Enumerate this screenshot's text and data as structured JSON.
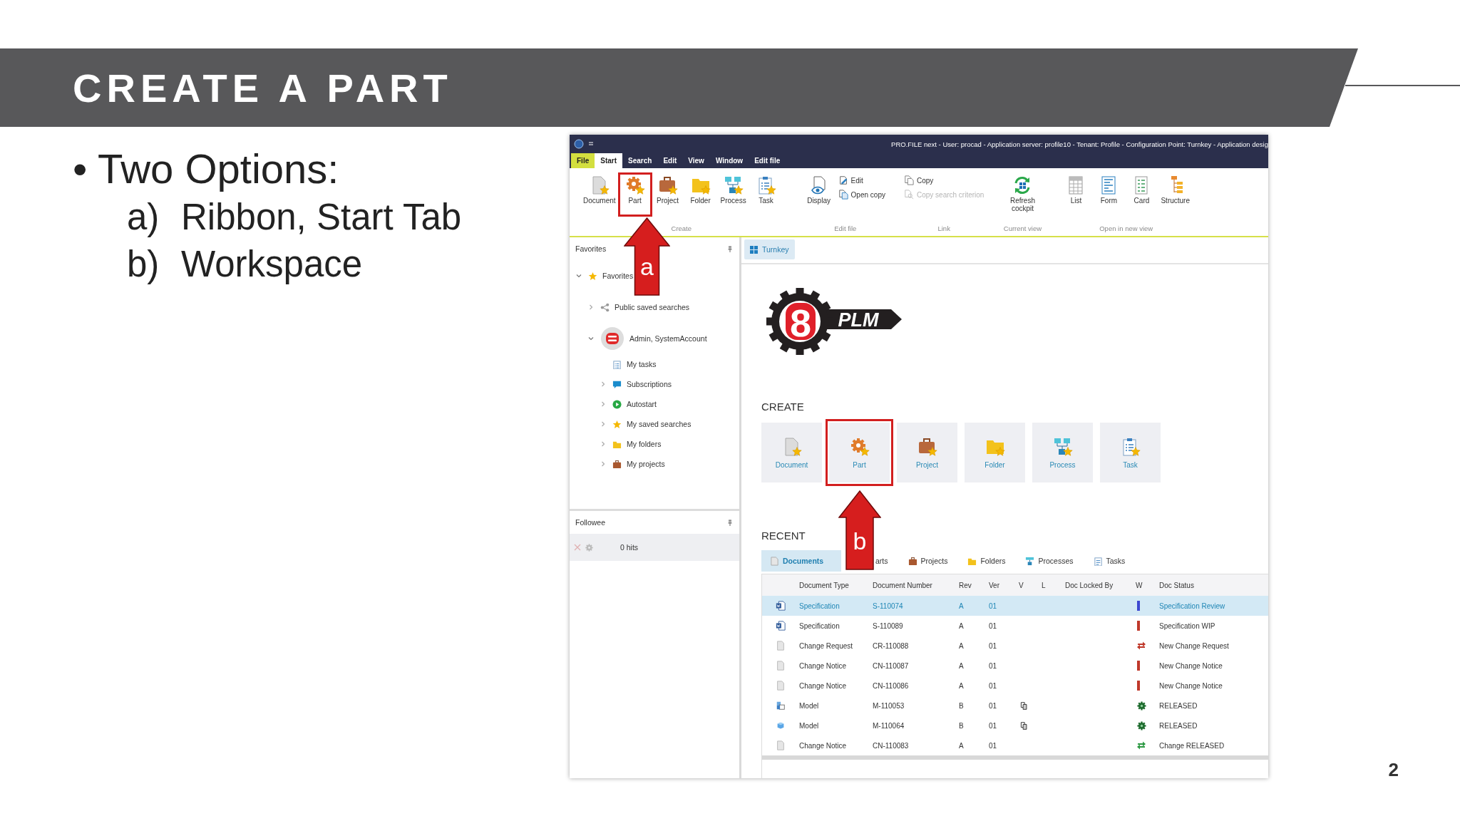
{
  "slide": {
    "title": "CREATE A PART",
    "bullets": [
      {
        "marker": "•",
        "text": "Two Options:",
        "children": [
          {
            "marker": "a)",
            "text": "Ribbon, Start Tab"
          },
          {
            "marker": "b)",
            "text": "Workspace"
          }
        ]
      }
    ],
    "page_number": "2"
  },
  "app": {
    "title_bar": {
      "title": "PRO.FILE next - User: procad - Application server: profile10 - Tenant: Profile - Configuration Point: Turnkey - Application desig"
    },
    "menu_tabs": [
      {
        "label": "File",
        "kind": "file",
        "selected": false
      },
      {
        "label": "Start",
        "kind": "tab",
        "selected": true
      },
      {
        "label": "Search",
        "kind": "tab",
        "selected": false
      },
      {
        "label": "Edit",
        "kind": "tab",
        "selected": false
      },
      {
        "label": "View",
        "kind": "tab",
        "selected": false
      },
      {
        "label": "Window",
        "kind": "tab",
        "selected": false
      },
      {
        "label": "Edit file",
        "kind": "tab",
        "selected": false
      }
    ],
    "ribbon": {
      "groups": [
        {
          "label": "Create",
          "items": [
            {
              "label": "Document",
              "kind": "large",
              "highlighted": false
            },
            {
              "label": "Part",
              "kind": "large",
              "highlighted": true
            },
            {
              "label": "Project",
              "kind": "large",
              "highlighted": false
            },
            {
              "label": "Folder",
              "kind": "large",
              "highlighted": false
            },
            {
              "label": "Process",
              "kind": "large",
              "highlighted": false
            },
            {
              "label": "Task",
              "kind": "large",
              "highlighted": false
            }
          ]
        },
        {
          "label": "Edit file",
          "items": [
            {
              "label": "Display",
              "kind": "large",
              "highlighted": false
            },
            {
              "label": "Edit",
              "kind": "small",
              "disabled": false
            },
            {
              "label": "Open copy",
              "kind": "small",
              "disabled": false
            }
          ]
        },
        {
          "label": "Link",
          "items": [
            {
              "label": "Copy",
              "kind": "small",
              "disabled": false
            },
            {
              "label": "Copy search criterion",
              "kind": "small",
              "disabled": true
            }
          ]
        },
        {
          "label": "Current view",
          "items": [
            {
              "label": "Refresh cockpit",
              "kind": "large",
              "highlighted": false
            }
          ]
        },
        {
          "label": "Open in new view",
          "items": [
            {
              "label": "List",
              "kind": "large",
              "highlighted": false
            },
            {
              "label": "Form",
              "kind": "large",
              "highlighted": false
            },
            {
              "label": "Card",
              "kind": "large",
              "highlighted": false
            },
            {
              "label": "Structure",
              "kind": "large",
              "highlighted": false
            }
          ]
        }
      ]
    },
    "favorites": {
      "title": "Favorites",
      "tree": [
        {
          "label": "Favorites",
          "expanded": true,
          "children": [
            {
              "label": "Public saved searches",
              "expanded": false
            },
            {
              "label": "Admin, SystemAccount",
              "expanded": true,
              "children": [
                {
                  "label": "My tasks"
                },
                {
                  "label": "Subscriptions",
                  "expanded": false
                },
                {
                  "label": "Autostart",
                  "expanded": false
                },
                {
                  "label": "My saved searches",
                  "expanded": false
                },
                {
                  "label": "My folders",
                  "expanded": false
                },
                {
                  "label": "My projects",
                  "expanded": false
                }
              ]
            }
          ]
        }
      ]
    },
    "followee": {
      "title": "Followee",
      "hits": "0 hits"
    },
    "workspace": {
      "tab": {
        "label": "Turnkey",
        "selected": true
      },
      "logo": {
        "mark": "8",
        "text": "PLM"
      },
      "create": {
        "title": "CREATE",
        "tiles": [
          {
            "label": "Document",
            "highlighted": false
          },
          {
            "label": "Part",
            "highlighted": true
          },
          {
            "label": "Project",
            "highlighted": false
          },
          {
            "label": "Folder",
            "highlighted": false
          },
          {
            "label": "Process",
            "highlighted": false
          },
          {
            "label": "Task",
            "highlighted": false
          }
        ]
      },
      "recent": {
        "title": "RECENT",
        "tabs": [
          {
            "label": "Documents",
            "selected": true
          },
          {
            "label": "arts",
            "selected": false
          },
          {
            "label": "Projects",
            "selected": false
          },
          {
            "label": "Folders",
            "selected": false
          },
          {
            "label": "Processes",
            "selected": false
          },
          {
            "label": "Tasks",
            "selected": false
          }
        ],
        "table": {
          "columns": [
            "Document Type",
            "Document Number",
            "Rev",
            "Ver",
            "V",
            "L",
            "Doc Locked By",
            "W",
            "Doc Status"
          ],
          "rows": [
            {
              "selected": true,
              "document_type": "Specification",
              "document_number": "S-110074",
              "rev": "A",
              "ver": "01",
              "v": false,
              "w": {
                "kind": "bar",
                "color": "#3d48d0"
              },
              "doc_status": "Specification Review"
            },
            {
              "selected": false,
              "document_type": "Specification",
              "document_number": "S-110089",
              "rev": "A",
              "ver": "01",
              "v": false,
              "w": {
                "kind": "bar",
                "color": "#c0392b"
              },
              "doc_status": "Specification WIP"
            },
            {
              "selected": false,
              "document_type": "Change Request",
              "document_number": "CR-110088",
              "rev": "A",
              "ver": "01",
              "v": false,
              "w": {
                "kind": "swap",
                "color": "#c0392b"
              },
              "doc_status": "New Change Request"
            },
            {
              "selected": false,
              "document_type": "Change Notice",
              "document_number": "CN-110087",
              "rev": "A",
              "ver": "01",
              "v": false,
              "w": {
                "kind": "bar",
                "color": "#c0392b"
              },
              "doc_status": "New Change Notice"
            },
            {
              "selected": false,
              "document_type": "Change Notice",
              "document_number": "CN-110086",
              "rev": "A",
              "ver": "01",
              "v": false,
              "w": {
                "kind": "bar",
                "color": "#c0392b"
              },
              "doc_status": "New Change Notice"
            },
            {
              "selected": false,
              "document_type": "Model",
              "document_number": "M-110053",
              "rev": "B",
              "ver": "01",
              "v": true,
              "w": {
                "kind": "gear",
                "color": "#1e6b2e"
              },
              "doc_status": "RELEASED"
            },
            {
              "selected": false,
              "document_type": "Model",
              "document_number": "M-110064",
              "rev": "B",
              "ver": "01",
              "v": true,
              "w": {
                "kind": "gear",
                "color": "#1e6b2e"
              },
              "doc_status": "RELEASED"
            },
            {
              "selected": false,
              "document_type": "Change Notice",
              "document_number": "CN-110083",
              "rev": "A",
              "ver": "01",
              "v": false,
              "w": {
                "kind": "swap",
                "color": "#2e9a44"
              },
              "doc_status": "Change RELEASED"
            }
          ]
        }
      }
    }
  },
  "annotations": [
    {
      "label": "a"
    },
    {
      "label": "b"
    }
  ]
}
